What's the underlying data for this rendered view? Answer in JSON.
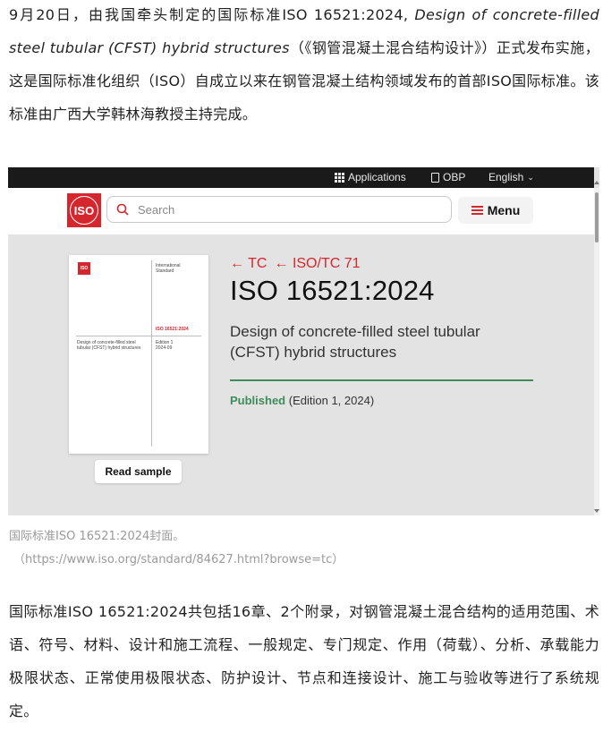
{
  "intro": {
    "before": "9月20日，由我国牵头制定的国际标准ISO 16521:2024, ",
    "title_en": "Design of concrete-filled steel tubular (CFST) hybrid structures",
    "after": "（《钢管混凝土混合结构设计》）正式发布实施，这是国际标准化组织（ISO）自成立以来在钢管混凝土结构领域发布的首部ISO国际标准。该标准由广西大学韩林海教授主持完成。"
  },
  "screenshot": {
    "topbar": {
      "applications": "Applications",
      "obp": "OBP",
      "language": "English"
    },
    "logo_text": "ISO",
    "search_placeholder": "Search",
    "menu_label": "Menu",
    "breadcrumb": [
      "TC",
      "ISO/TC 71"
    ],
    "standard_id": "ISO 16521:2024",
    "standard_desc": "Design of concrete-filled steel tubular (CFST) hybrid structures",
    "status": "Published",
    "edition": "(Edition 1, 2024)",
    "read_sample": "Read sample",
    "cover": {
      "logo": "ISO",
      "type_line1": "International",
      "type_line2": "Standard",
      "number": "ISO 16521:2024",
      "title_line1": "Design of concrete-filled steel",
      "title_line2": "tubular (CFST) hybrid structures",
      "edition_line1": "Edition 1",
      "edition_line2": "2024-09"
    },
    "colors": {
      "iso_red": "#d6262d",
      "published_green": "#3d8c5a",
      "topbar": "#1a1a1a",
      "panel": "#e3e3e3"
    }
  },
  "caption": {
    "line1": "国际标准ISO 16521:2024封面。",
    "line2": "（https://www.iso.org/standard/84627.html?browse=tc）"
  },
  "body_text": "国际标准ISO 16521:2024共包括16章、2个附录，对钢管混凝土混合结构的适用范围、术语、符号、材料、设计和施工流程、一般规定、专门规定、作用（荷载）、分析、承载能力极限状态、正常使用极限状态、防护设计、节点和连接设计、施工与验收等进行了系统规定。"
}
